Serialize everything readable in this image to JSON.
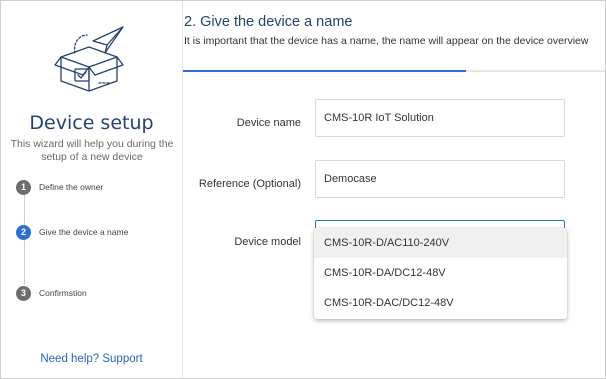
{
  "sidebar": {
    "title": "Device setup",
    "description": "This wizard will help you during the setup of a new device",
    "steps": [
      {
        "number": "1",
        "label": "Define the owner",
        "active": false
      },
      {
        "number": "2",
        "label": "Give the device a name",
        "active": true
      },
      {
        "number": "3",
        "label": "Confirmstion",
        "active": false
      }
    ],
    "help_link": "Need help? Support"
  },
  "main": {
    "title": "2. Give the device a name",
    "subtitle": "It is important that the device has a name, the name will appear on the device overview",
    "progress": 0.67,
    "fields": {
      "device_name": {
        "label": "Device name",
        "value": "CMS-10R IoT Solution"
      },
      "reference": {
        "label": "Reference (Optional)",
        "value": "Democase"
      },
      "device_model": {
        "label": "Device model",
        "options": [
          "CMS-10R-D/AC110-240V",
          "CMS-10R-DA/DC12-48V",
          "CMS-10R-DAC/DC12-48V"
        ],
        "highlighted_index": 0
      }
    }
  },
  "colors": {
    "accent": "#2b6fcf",
    "title": "#26426e",
    "link": "#2b64b8",
    "step_inactive": "#6d6d6d"
  }
}
